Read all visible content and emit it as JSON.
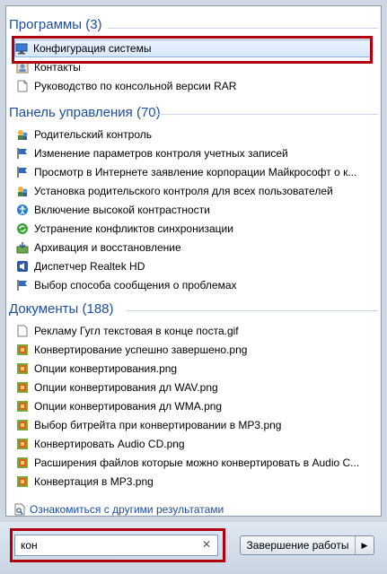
{
  "programs": {
    "header": "Программы (3)",
    "items": [
      {
        "label": "Конфигурация системы",
        "icon": "system-config-icon",
        "selected": true
      },
      {
        "label": "Контакты",
        "icon": "contacts-icon"
      },
      {
        "label": "Руководство по консольной версии RAR",
        "icon": "document-icon"
      }
    ]
  },
  "control_panel": {
    "header": "Панель управления (70)",
    "items": [
      {
        "label": "Родительский контроль",
        "icon": "parental-control-icon"
      },
      {
        "label": "Изменение параметров контроля учетных записей",
        "icon": "flag-icon"
      },
      {
        "label": "Просмотр в Интернете заявление корпорации Майкрософт о к...",
        "icon": "flag-icon"
      },
      {
        "label": "Установка родительского контроля для всех пользователей",
        "icon": "parental-control-icon"
      },
      {
        "label": "Включение высокой контрастности",
        "icon": "accessibility-icon"
      },
      {
        "label": "Устранение конфликтов синхронизации",
        "icon": "sync-icon"
      },
      {
        "label": "Архивация и восстановление",
        "icon": "backup-icon"
      },
      {
        "label": "Диспетчер Realtek HD",
        "icon": "speaker-icon"
      },
      {
        "label": "Выбор способа сообщения о проблемах",
        "icon": "flag-icon"
      }
    ]
  },
  "documents": {
    "header": "Документы (188)",
    "items": [
      {
        "label": "Рекламу Гугл текстовая в конце поста.gif",
        "icon": "image-file-icon"
      },
      {
        "label": "Конвертирование успешно завершено.png",
        "icon": "image-file-icon"
      },
      {
        "label": "Опции конвертирования.png",
        "icon": "image-file-icon"
      },
      {
        "label": "Опции конвертирования дл WAV.png",
        "icon": "image-file-icon"
      },
      {
        "label": "Опции конвертирования дл WMA.png",
        "icon": "image-file-icon"
      },
      {
        "label": "Выбор битрейта при конвертировании в MP3.png",
        "icon": "image-file-icon"
      },
      {
        "label": "Конвертировать Audio CD.png",
        "icon": "image-file-icon"
      },
      {
        "label": "Расширения файлов которые можно конвертировать в Audio C...",
        "icon": "image-file-icon"
      },
      {
        "label": "Конвертация в MP3.png",
        "icon": "image-file-icon"
      }
    ]
  },
  "more_results": "Ознакомиться с другими результатами",
  "search": {
    "value": "кон",
    "clear_glyph": "✕"
  },
  "shutdown": {
    "label": "Завершение работы",
    "arrow": "▶"
  },
  "colors": {
    "header": "#1e4fa0",
    "highlight": "#b00010",
    "panel_border": "#8a9bb0"
  }
}
